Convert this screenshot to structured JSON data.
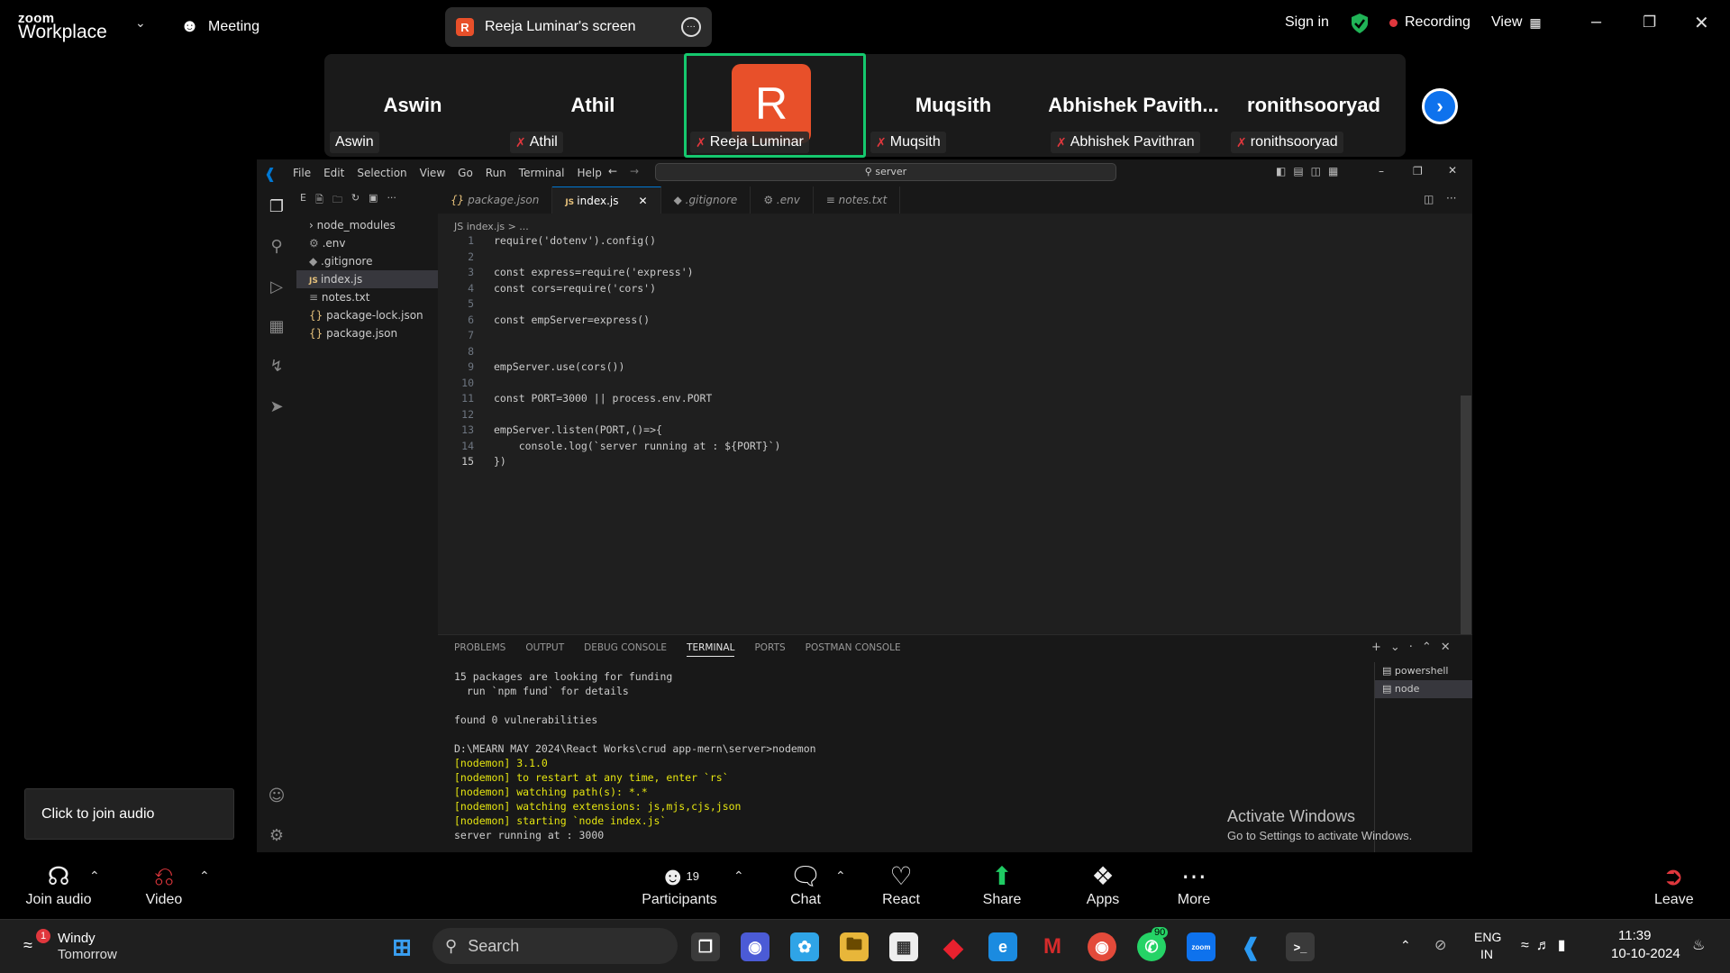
{
  "zoom": {
    "logo_small": "zoom",
    "logo_big": "Workplace",
    "meeting_label": "Meeting",
    "screen_share_label": "Reeja Luminar's screen",
    "screen_share_badge": "R",
    "sign_in": "Sign in",
    "recording": "Recording",
    "view": "View",
    "tooltip": "Click to join audio"
  },
  "participants": [
    {
      "name": "Aswin",
      "label": "Aswin",
      "muted": false
    },
    {
      "name": "Athil",
      "label": "Athil",
      "muted": true
    },
    {
      "name": "R",
      "label": "Reeja Luminar",
      "muted": true,
      "active": true
    },
    {
      "name": "Muqsith",
      "label": "Muqsith",
      "muted": true
    },
    {
      "name": "Abhishek Pavith...",
      "label": "Abhishek Pavithran",
      "muted": true
    },
    {
      "name": "ronithsooryad",
      "label": "ronithsooryad",
      "muted": true
    }
  ],
  "vscode": {
    "menu": [
      "File",
      "Edit",
      "Selection",
      "View",
      "Go",
      "Run",
      "Terminal",
      "Help"
    ],
    "search": "server",
    "explorer_short": "E",
    "files": [
      "node_modules",
      ".env",
      ".gitignore",
      "index.js",
      "notes.txt",
      "package-lock.json",
      "package.json"
    ],
    "tabs": [
      "package.json",
      "index.js",
      ".gitignore",
      ".env",
      "notes.txt"
    ],
    "breadcrumb": "JS index.js > ...",
    "code": [
      "require('dotenv').config()",
      "",
      "const express=require('express')",
      "const cors=require('cors')",
      "",
      "const empServer=express()",
      "",
      "",
      "empServer.use(cors())",
      "",
      "const PORT=3000 || process.env.PORT",
      "",
      "empServer.listen(PORT,()=>{",
      "    console.log(`server running at : ${PORT}`)",
      "})"
    ],
    "panel_tabs": [
      "PROBLEMS",
      "OUTPUT",
      "DEBUG CONSOLE",
      "TERMINAL",
      "PORTS",
      "POSTMAN CONSOLE"
    ],
    "terminal": [
      "15 packages are looking for funding",
      "  run `npm fund` for details",
      "",
      "found 0 vulnerabilities",
      "",
      "D:\\MEARN MAY 2024\\React Works\\crud app-mern\\server>nodemon",
      "[nodemon] 3.1.0",
      "[nodemon] to restart at any time, enter `rs`",
      "[nodemon] watching path(s): *.*",
      "[nodemon] watching extensions: js,mjs,cjs,json",
      "[nodemon] starting `node index.js`",
      "server running at : 3000"
    ],
    "terminal_list": [
      "powershell",
      "node"
    ],
    "activate_title": "Activate Windows",
    "activate_sub": "Go to Settings to activate Windows."
  },
  "toolbar": {
    "join_audio": "Join audio",
    "video": "Video",
    "participants": "Participants",
    "participants_count": "19",
    "chat": "Chat",
    "react": "React",
    "share": "Share",
    "apps": "Apps",
    "more": "More",
    "leave": "Leave"
  },
  "taskbar": {
    "weather_title": "Windy",
    "weather_sub": "Tomorrow",
    "weather_badge": "1",
    "search": "Search",
    "whatsapp_badge": "90",
    "lang1": "ENG",
    "lang2": "IN",
    "time": "11:39",
    "date": "10-10-2024"
  },
  "colors": {
    "zoom_blue": "#0e72ed",
    "active_speaker": "#15c86e",
    "avatar": "#e8502a",
    "recording_dot": "#e0373d"
  }
}
